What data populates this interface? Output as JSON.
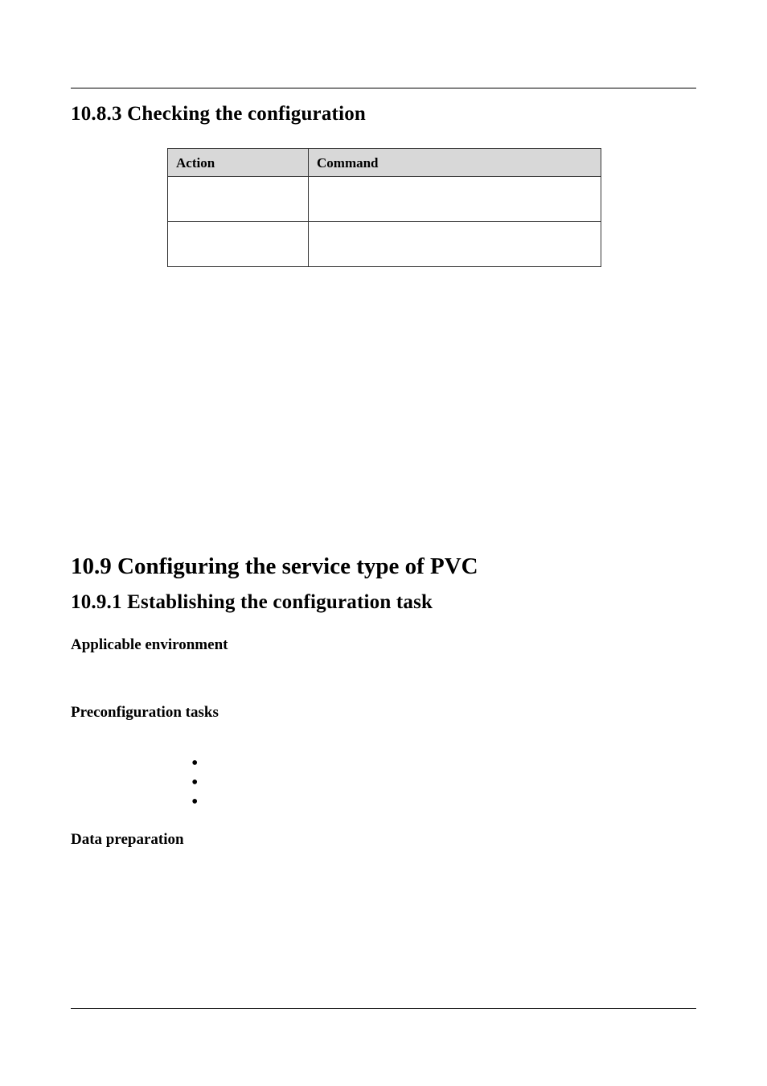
{
  "section_10_8_3": {
    "heading": "10.8.3 Checking the configuration",
    "table": {
      "headers": {
        "action": "Action",
        "command": "Command"
      },
      "rows": [
        {
          "action": "",
          "command": ""
        },
        {
          "action": "",
          "command": ""
        }
      ]
    }
  },
  "section_10_9": {
    "heading": "10.9 Configuring the service type of PVC"
  },
  "section_10_9_1": {
    "heading": "10.9.1 Establishing the configuration task",
    "applicable_env": {
      "heading": "Applicable environment",
      "body": ""
    },
    "preconfig": {
      "heading": "Preconfiguration tasks",
      "intro": "",
      "items": [
        "",
        "",
        ""
      ]
    },
    "data_prep": {
      "heading": "Data preparation",
      "body": ""
    }
  }
}
